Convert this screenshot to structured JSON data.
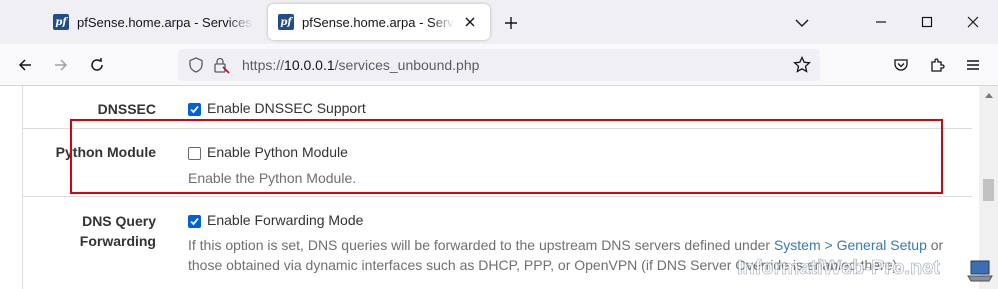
{
  "browser": {
    "tabs": [
      {
        "title": "pfSense.home.arpa - Services: DNS Resolver: General Settings",
        "favicon": "pf",
        "active": false
      },
      {
        "title": "pfSense.home.arpa - Services: DNS Resolver: General Settings",
        "favicon": "pf",
        "active": true
      }
    ],
    "url": {
      "scheme": "https://",
      "host": "10.0.0.1",
      "path": "/services_unbound.php"
    }
  },
  "settings": {
    "dnssec": {
      "label": "DNSSEC",
      "checkbox_label": "Enable DNSSEC Support",
      "checked": true
    },
    "python_module": {
      "label": "Python Module",
      "checkbox_label": "Enable Python Module",
      "checked": false,
      "help": "Enable the Python Module."
    },
    "dns_query_forwarding": {
      "label_line1": "DNS Query",
      "label_line2": "Forwarding",
      "checkbox_label": "Enable Forwarding Mode",
      "checked": true,
      "help_prefix": "If this option is set, DNS queries will be forwarded to the upstream DNS servers defined under ",
      "help_link": "System > General Setup",
      "help_suffix": " or",
      "help_line2": "those obtained via dynamic interfaces such as DHCP, PPP, or OpenVPN (if DNS Server Override is enabled there)."
    }
  },
  "watermark": "InformatiWeb-Pro.net",
  "colors": {
    "accent": "#0060df",
    "highlight_border": "#e0000d",
    "link": "#337ab7"
  }
}
